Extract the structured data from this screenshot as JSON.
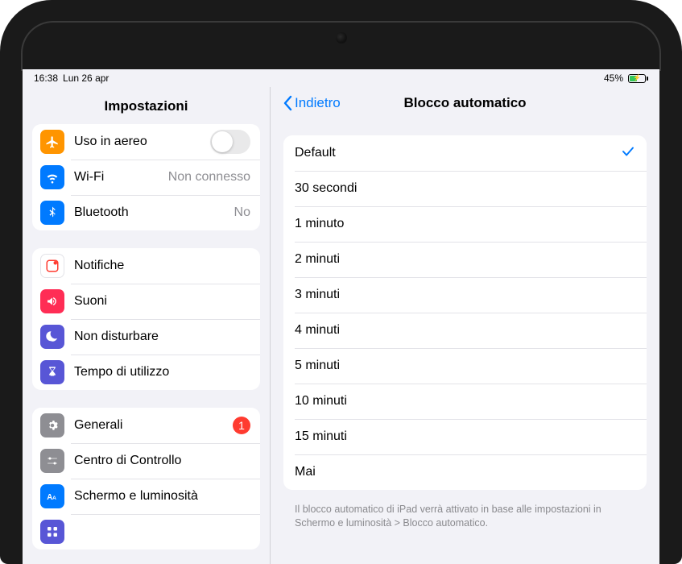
{
  "status": {
    "time": "16:38",
    "date": "Lun 26 apr",
    "battery_pct": "45%"
  },
  "sidebar": {
    "title": "Impostazioni",
    "groups": [
      {
        "rows": [
          {
            "icon": "airplane",
            "label": "Uso in aereo",
            "control": "switch"
          },
          {
            "icon": "wifi",
            "label": "Wi-Fi",
            "detail": "Non connesso"
          },
          {
            "icon": "bluetooth",
            "label": "Bluetooth",
            "detail": "No"
          }
        ]
      },
      {
        "rows": [
          {
            "icon": "notifications",
            "label": "Notifiche"
          },
          {
            "icon": "sounds",
            "label": "Suoni"
          },
          {
            "icon": "dnd",
            "label": "Non disturbare"
          },
          {
            "icon": "screentime",
            "label": "Tempo di utilizzo"
          }
        ]
      },
      {
        "rows": [
          {
            "icon": "general",
            "label": "Generali",
            "badge": "1"
          },
          {
            "icon": "control-center",
            "label": "Centro di Controllo"
          },
          {
            "icon": "display",
            "label": "Schermo e luminosità"
          },
          {
            "icon": "home",
            "label": ""
          }
        ]
      }
    ]
  },
  "detail": {
    "back_label": "Indietro",
    "title": "Blocco automatico",
    "options": [
      {
        "label": "Default",
        "selected": true
      },
      {
        "label": "30 secondi"
      },
      {
        "label": "1 minuto"
      },
      {
        "label": "2 minuti"
      },
      {
        "label": "3 minuti"
      },
      {
        "label": "4 minuti"
      },
      {
        "label": "5 minuti"
      },
      {
        "label": "10 minuti"
      },
      {
        "label": "15 minuti"
      },
      {
        "label": "Mai"
      }
    ],
    "footer": "Il blocco automatico di iPad verrà attivato in base alle impostazioni in Schermo e luminosità > Blocco automatico."
  }
}
